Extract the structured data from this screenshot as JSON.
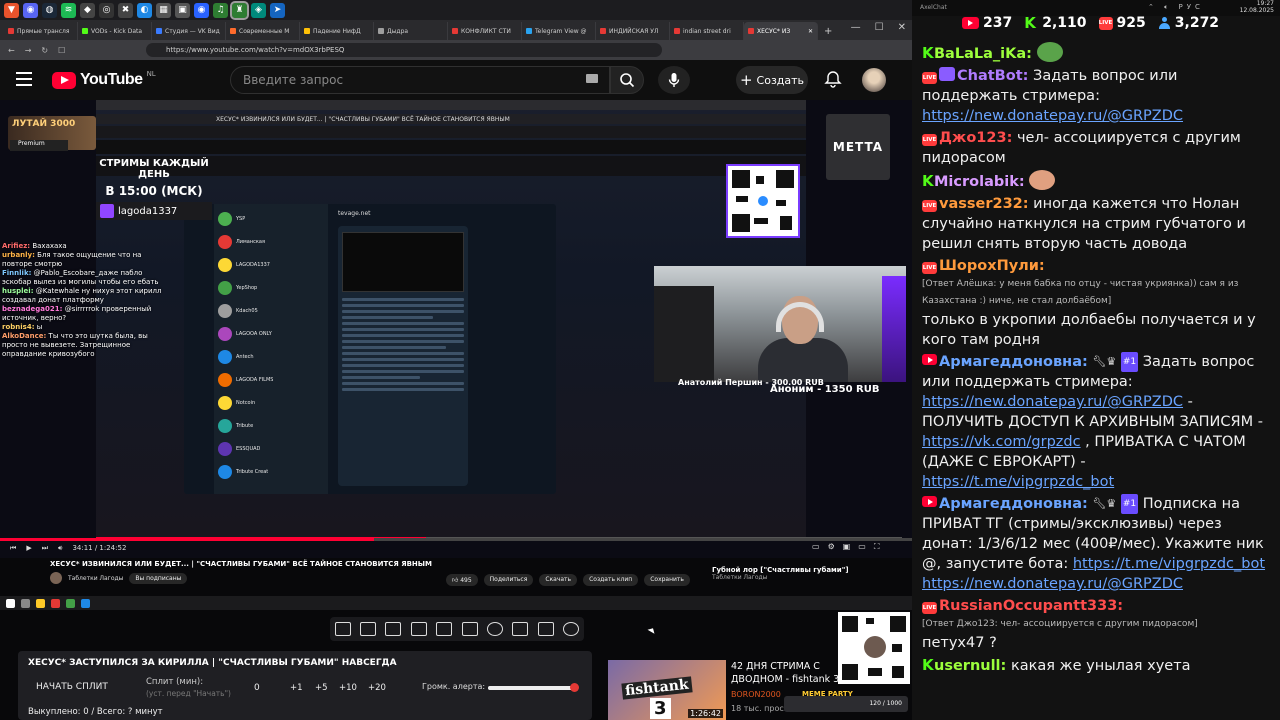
{
  "browser": {
    "tabs": [
      {
        "label": "Прямые трансля",
        "color": "#e53935"
      },
      {
        "label": "VODs - Kick Data",
        "color": "#53fc18"
      },
      {
        "label": "Студия — VK Вид",
        "color": "#3a7bff"
      },
      {
        "label": "Современные М",
        "color": "#ff6b2c"
      },
      {
        "label": "Падение НифД",
        "color": "#ffc107"
      },
      {
        "label": "Дыдра",
        "color": "#9e9e9e"
      },
      {
        "label": "КОНФЛИКТ СТИ",
        "color": "#e53935"
      },
      {
        "label": "Telegram View @",
        "color": "#2aa3ef"
      },
      {
        "label": "ИНДИЙСКАЯ УЛ",
        "color": "#e53935"
      },
      {
        "label": "indian street dri",
        "color": "#e53935"
      },
      {
        "label": "ХЕСУС* ИЗ",
        "color": "#e53935"
      }
    ],
    "url": "https://www.youtube.com/watch?v=mdOX3rbPESQ"
  },
  "youtube": {
    "logo_text": "YouTube",
    "region": "NL",
    "search_placeholder": "Введите запрос",
    "create_label": "Создать"
  },
  "video_overlay": {
    "lutai_text": "ЛУТАЙ 3000",
    "premium_text": "Premium",
    "schedule_line1": "СТРИМЫ КАЖДЫЙ ДЕНЬ",
    "schedule_line2": "В 15:00 (МСК)",
    "twitch_handle": "lagoda1337",
    "metta_text": "METTA",
    "donor_line1": "Анатолий Першин - 300.00 RUB",
    "donor_line2": "Аноним - 1350 RUB",
    "mini_chat": [
      {
        "name": "Arifiez:",
        "text": "Вахахаха",
        "color": "#ff6b6b"
      },
      {
        "name": "urbanly:",
        "text": "Бля такое ощущение что на повторе смотрю",
        "color": "#ffb347"
      },
      {
        "name": "Finnlik:",
        "text": "@Pablo_Escobare_дажe пабло эскобар вылез из могилы чтобы его ебать",
        "color": "#7ec8ff"
      },
      {
        "name": "husplei:",
        "text": "@Katewhale ну нихуя этот кирилл создавал донат платформу",
        "color": "#9dff9d"
      },
      {
        "name": "beznadega021:",
        "text": "@sirrrrrok проверенный источник, верно?",
        "color": "#ff7ad9"
      },
      {
        "name": "robnis4:",
        "text": "ы",
        "color": "#ffd166"
      },
      {
        "name": "AlkoDance:",
        "text": "Ты что это шутка была, вы просто не вывезете. Затрещинное оправдание кривозубого",
        "color": "#ff9e6b"
      }
    ],
    "telegram_channel": "tevage.net",
    "telegram_chats": [
      {
        "name": "YSP",
        "color": "#4caf50"
      },
      {
        "name": "Лиманская",
        "color": "#e53935"
      },
      {
        "name": "LAGODA1337",
        "color": "#fdd835"
      },
      {
        "name": "YepShop",
        "color": "#43a047"
      },
      {
        "name": "Kdach05",
        "color": "#9e9e9e"
      },
      {
        "name": "LAGOOA ONLY",
        "color": "#ab47bc"
      },
      {
        "name": "Antech",
        "color": "#1e88e5"
      },
      {
        "name": "LAGODA FILMS",
        "color": "#ef6c00"
      },
      {
        "name": "Notcoin",
        "color": "#fdd835"
      },
      {
        "name": "Tribute",
        "color": "#26a69a"
      },
      {
        "name": "ESSQUAD",
        "color": "#5e35b1"
      },
      {
        "name": "Tribute Creat",
        "color": "#1e88e5"
      }
    ]
  },
  "player": {
    "time": "34:11 / 1:24:52",
    "progress_fraction": 0.41,
    "under_title": "ХЕСУС* ИЗВИНИЛСЯ ИЛИ БУДЕТ... | \"СЧАСТЛИВЫ ГУБАМИ\" ВСЁ ТАЙНОЕ СТАНОВИТСЯ ЯВНЫМ",
    "under_channel": "Таблетки Лагоды",
    "subscribed_label": "Вы подписаны",
    "likes": "495",
    "share_label": "Поделиться",
    "download_label": "Скачать",
    "clip_label": "Создать клип",
    "save_label": "Сохранить",
    "side_title": "Губной лор [\"Счастливы губами\"]",
    "side_channel": "Таблетки Лагоды"
  },
  "split_widget": {
    "title": "ХЕСУС* ЗАСТУПИЛСЯ ЗА КИРИЛЛА | \"СЧАСТЛИВЫ ГУБАМИ\" НАВСЕГДА",
    "start_button": "НАЧАТЬ СПЛИТ",
    "split_label": "Сплит (мин):",
    "split_hint": "(уст. перед \"Начать\")",
    "split_value": "0",
    "buttons": [
      "+1",
      "+5",
      "+10",
      "+20"
    ],
    "alert_label": "Громк. алерта:",
    "alert_volume_fraction": 0.98,
    "bought_text": "Выкуплено: 0 / Всего: ? минут"
  },
  "recommendation": {
    "title": "42 ДНЯ СТРИМА С ДВОДНОМ - fishtank 3",
    "channel": "BORON2000",
    "views": "18 тыс. просм",
    "duration": "1:26:42",
    "thumb_logo": "fishtank",
    "thumb_num": "3"
  },
  "meme_party": {
    "label": "MEME PARTY",
    "count": "120 / 1000"
  },
  "chat": {
    "app_name": "AxelChat",
    "clock_time": "19:27",
    "clock_date": "12.08.2025",
    "lang": "РУС",
    "stats": {
      "youtube": "237",
      "kick": "2,110",
      "vk": "925",
      "viewers": "3,272"
    },
    "messages": [
      {
        "platform": "kick",
        "name": "BaLaLa_iKa:",
        "name_color": "#9dff3c",
        "text": "",
        "emote": "#5aa34a"
      },
      {
        "platform": "vk",
        "name": "ChatBot:",
        "name_color": "#b07cff",
        "bot": true,
        "text": "Задать вопрос или поддержать стримера: ",
        "link": "https://new.donatepay.ru/@GRPZDC"
      },
      {
        "platform": "vk",
        "name": "Джо123:",
        "name_color": "#ff4d4d",
        "text": "чел- ассоциируется с другим пидорасом"
      },
      {
        "platform": "kick",
        "name": "Microlabik:",
        "name_color": "#d89bff",
        "text": "",
        "emote": "#e0a080"
      },
      {
        "platform": "vk",
        "name": "vasser232:",
        "name_color": "#ff9a3c",
        "text": "иногда кажется что Нолан случайно наткнулся на стрим губчатого и решил снять вторую часть довода"
      },
      {
        "platform": "vk",
        "name": "ШорохПули:",
        "name_color": "#ff9a3c",
        "reply": "[Ответ Алёшка: у меня бабка по отцу - чистая укриянка)) сам я из Казахстана :) ниче, не стал долбаёбом]",
        "text": "только в укропии долбаебы получается и у кого там родня"
      },
      {
        "platform": "yt",
        "name": "Армагеддоновна:",
        "name_color": "#6aa4ff",
        "mod": true,
        "level": "#1",
        "text": "Задать вопрос или поддержать стримера: ",
        "link": "https://new.donatepay.ru/@GRPZDC",
        "text2": " - ПОЛУЧИТЬ ДОСТУП К АРХИВНЫМ ЗАПИСЯМ - ",
        "link2": "https://vk.com/grpzdc",
        "text3": " , ПРИВАТКА С ЧАТОМ (ДАЖЕ С ЕВРОКАРТ) - ",
        "link3": "https://t.me/vipgrpzdc_bot"
      },
      {
        "platform": "yt",
        "name": "Армагеддоновна:",
        "name_color": "#6aa4ff",
        "mod": true,
        "level": "#1",
        "text": "Подписка на ПРИВАТ ТГ (стримы/эксклюзивы) через донат: 1/3/6/12 мес (400₽/мес). Укажите ник @, запустите бота: ",
        "link": "https://t.me/vipgrpzdc_bot",
        "text2": " ",
        "link2": "https://new.donatepay.ru/@GRPZDC"
      },
      {
        "platform": "vk",
        "name": "RussianOccupantt333:",
        "name_color": "#ff4d4d",
        "reply": "[Ответ Джо123: чел- ассоциируется с другим пидорасом]",
        "text": "петух47 ?"
      },
      {
        "platform": "kick",
        "name": "usernull:",
        "name_color": "#9dff3c",
        "text": "какая же унылая хуета"
      }
    ]
  }
}
